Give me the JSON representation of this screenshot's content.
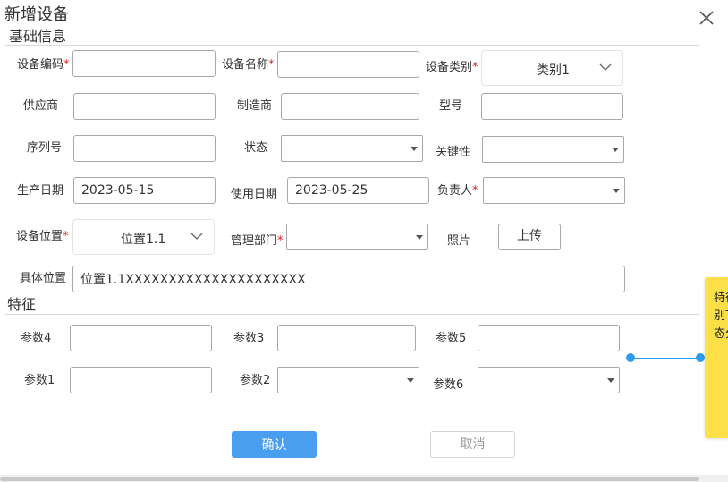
{
  "dialog": {
    "title": "新增设备"
  },
  "sections": {
    "basic": "基础信息",
    "features": "特征"
  },
  "fields": {
    "code": {
      "label": "设备编码",
      "required": "*",
      "value": ""
    },
    "name": {
      "label": "设备名称",
      "required": "*",
      "value": ""
    },
    "category": {
      "label": "设备类别",
      "required": "*",
      "value": "类别1"
    },
    "supplier": {
      "label": "供应商",
      "value": ""
    },
    "manufacturer": {
      "label": "制造商",
      "value": ""
    },
    "model": {
      "label": "型号",
      "value": ""
    },
    "serial": {
      "label": "序列号",
      "value": ""
    },
    "status": {
      "label": "状态",
      "value": ""
    },
    "criticality": {
      "label": "关键性",
      "value": ""
    },
    "production_date": {
      "label": "生产日期",
      "value": "2023-05-15"
    },
    "use_date": {
      "label": "使用日期",
      "value": "2023-05-25"
    },
    "owner": {
      "label": "负责人",
      "required": "*",
      "value": ""
    },
    "location": {
      "label": "设备位置",
      "required": "*",
      "value": "位置1.1"
    },
    "department": {
      "label": "管理部门",
      "required": "*",
      "value": ""
    },
    "photo": {
      "label": "照片",
      "button": "上传"
    },
    "detail_location": {
      "label": "具体位置",
      "value": "位置1.1XXXXXXXXXXXXXXXXXXXXX"
    }
  },
  "features": {
    "p4": {
      "label": "参数4",
      "value": ""
    },
    "p3": {
      "label": "参数3",
      "value": ""
    },
    "p5": {
      "label": "参数5",
      "value": ""
    },
    "p1": {
      "label": "参数1",
      "value": ""
    },
    "p2": {
      "label": "参数2",
      "value": ""
    },
    "p6": {
      "label": "参数6",
      "value": ""
    }
  },
  "buttons": {
    "confirm": "确认",
    "cancel": "取消"
  },
  "sticky_note": {
    "lines": [
      "特征",
      "别下",
      "态分"
    ]
  },
  "colors": {
    "primary": "#4a9ef0",
    "required": "#e02020",
    "note": "#fde047",
    "connector": "#2b9bf0"
  },
  "icons": {
    "close": "close-icon",
    "dropdown": "chevron-down-icon",
    "select": "caret-down-icon"
  }
}
